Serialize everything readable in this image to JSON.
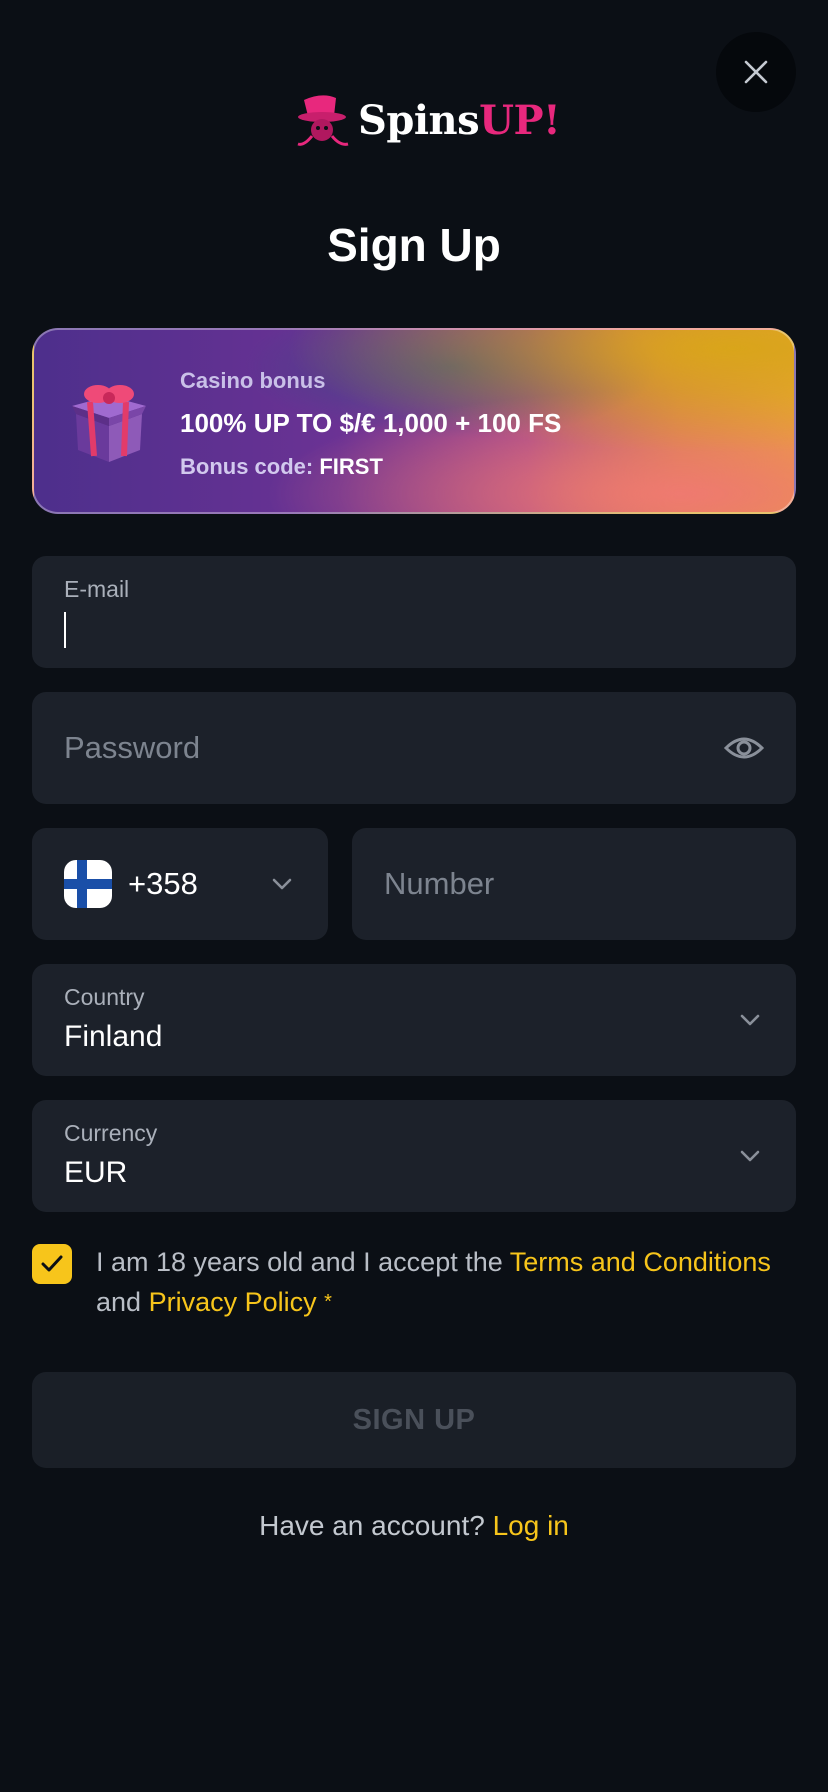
{
  "header": {
    "logo_text_white": "Spins",
    "logo_text_pink": "UP!",
    "close_icon": "close-icon"
  },
  "title": "Sign Up",
  "bonus": {
    "label": "Casino bonus",
    "amount": "100% UP TO $/€ 1,000 + 100 FS",
    "code_label": "Bonus code:",
    "code_value": "FIRST",
    "icon": "gift-icon"
  },
  "form": {
    "email": {
      "label": "E-mail",
      "value": ""
    },
    "password": {
      "placeholder": "Password",
      "icon": "eye-icon"
    },
    "phone_code": {
      "flag": "finland-flag",
      "value": "+358"
    },
    "phone_number": {
      "placeholder": "Number"
    },
    "country": {
      "label": "Country",
      "value": "Finland"
    },
    "currency": {
      "label": "Currency",
      "value": "EUR"
    }
  },
  "consent": {
    "text_before": "I am 18 years old and I accept the",
    "terms_link": "Terms and Conditions",
    "text_and": "and",
    "privacy_link": "Privacy Policy",
    "required_mark": "*",
    "checked": true
  },
  "signup_button": "SIGN UP",
  "footer": {
    "prompt": "Have an account?",
    "login_link": "Log in"
  },
  "colors": {
    "background": "#0b0f15",
    "field_bg": "#1c212a",
    "accent_yellow": "#f7c51b",
    "brand_pink": "#e8287d"
  }
}
